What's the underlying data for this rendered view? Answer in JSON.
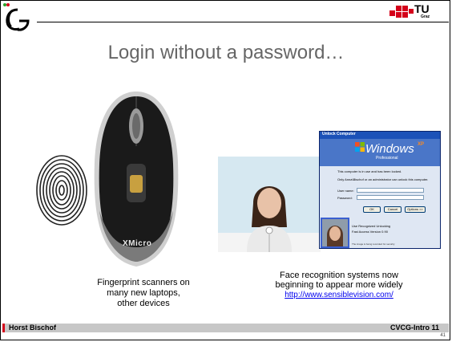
{
  "slide": {
    "title": "Login without a password…",
    "left_caption": {
      "line1": "Fingerprint scanners on",
      "line2": "many new laptops,",
      "line3": "other devices"
    },
    "right_caption": {
      "line1": "Face recognition systems now",
      "line2": "beginning to appear more widely",
      "link": "http://www.sensiblevision.com/"
    },
    "mouse_brand": "XMicro",
    "tu_logo_text": "TU",
    "tu_logo_sub": "Graz",
    "windows_dialog": {
      "title": "Unlock Computer",
      "logo": "Windows",
      "edition": "XP",
      "subtitle": "Professional",
      "message1": "This computer is in use and has been locked.",
      "message2": "Only Anna\\Bischof or an administrator can unlock this computer.",
      "user_label": "User name:",
      "password_label": "Password:",
      "ok": "OK",
      "cancel": "Cancel",
      "options": "Options >>",
      "status1": "Use Recognized Unlocking",
      "status2": "Fast Access Version 0.90",
      "status3": "The image is being recorded for security"
    }
  },
  "footer": {
    "author": "Horst Bischof",
    "course": "CVCG-Intro 11",
    "page": "41"
  },
  "colors": {
    "title": "#666666",
    "footer_bar": "#c7c7c7",
    "accent_red": "#d4001a",
    "link": "#0000ee"
  }
}
